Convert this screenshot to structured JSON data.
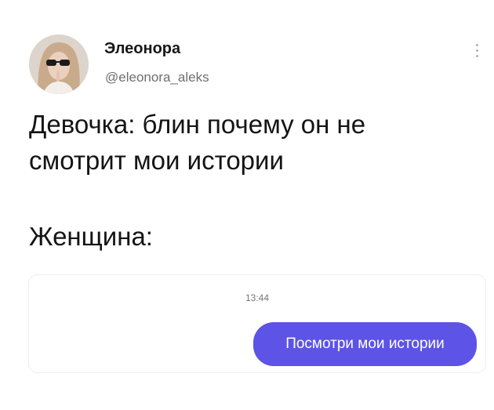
{
  "post": {
    "author_name": "Элеонора",
    "author_handle": "@eleonora_aleks",
    "avatar_icon": "user-photo-avatar",
    "more_icon": "vertical-ellipsis",
    "text_lines": [
      "Девочка: блин почему он не",
      "смотрит мои истории",
      "Женщина:"
    ]
  },
  "chat": {
    "time": "13:44",
    "message": "Посмотри мои истории",
    "bubble_color": "#5d53e6"
  }
}
